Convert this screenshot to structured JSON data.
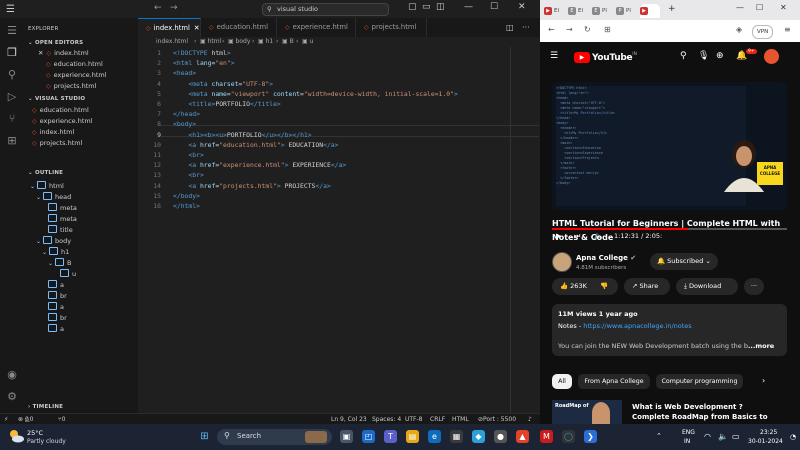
{
  "vscode": {
    "search": "visual studio",
    "explorer_title": "EXPLORER",
    "open_editors_title": "OPEN EDITORS",
    "open_editors": [
      "index.html",
      "education.html",
      "experience.html",
      "projects.html"
    ],
    "folder_title": "VISUAL STUDIO",
    "folder_files": [
      "education.html",
      "experience.html",
      "index.html",
      "projects.html"
    ],
    "outline_title": "OUTLINE",
    "outline": [
      "html",
      "head",
      "meta",
      "meta",
      "title",
      "body",
      "h1",
      "B",
      "u",
      "a",
      "br",
      "a",
      "br",
      "a"
    ],
    "timeline_title": "TIMELINE",
    "tabs": [
      "index.html",
      "education.html",
      "experience.html",
      "projects.html"
    ],
    "breadcrumb": [
      "index.html",
      "html",
      "body",
      "h1",
      "B",
      "u"
    ],
    "status": {
      "errors": "0",
      "warnings": "0",
      "ports": "0",
      "position": "Ln 9, Col 23",
      "spaces": "Spaces: 4",
      "encoding": "UTF-8",
      "eol": "CRLF",
      "language": "HTML",
      "port": "Port : 5500"
    },
    "code_lines": [
      "<!DOCTYPE html>",
      "<html lang=\"en\">",
      "<head>",
      "    <meta charset=\"UTF-8\">",
      "    <meta name=\"viewport\" content=\"width=device-width, initial-scale=1.0\">",
      "    <title>PORTFOLIO</title>",
      "</head>",
      "<body>",
      "    <h1><b><u>PORTFOLIO</u></b></h1>",
      "    <a href=\"education.html\"> EDUCATION</a>",
      "    <br>",
      "    <a href=\"experience.html\"> EXPERIENCE</a>",
      "    <br>",
      "    <a href=\"projects.html\"> PROJECTS</a>",
      "</body>",
      "</html>"
    ]
  },
  "browser": {
    "tab_labels": [
      "El",
      "El",
      "Pl",
      "Pl"
    ],
    "vpn": "VPN",
    "yt_brand": "YouTube",
    "yt_region": "IN",
    "notif_count": "9+",
    "time": "1:12:31 / 2:05:",
    "title_lines": [
      "HTML Tutorial for Beginners | Complete HTML with",
      "Notes & Code"
    ],
    "channel": "Apna College",
    "subs": "4.81M subscribers",
    "subscribed": "Subscribed",
    "likes": "263K",
    "share": "Share",
    "download": "Download",
    "more": "···",
    "views": "11M views  1 year ago",
    "notes_label": "Notes - ",
    "notes_link": "https://www.apnacollege.in/notes",
    "desc_text": "You can join the  NEW Web Development batch using the b",
    "desc_more": "...more",
    "chips": [
      "All",
      "From Apna College",
      "Computer programming"
    ],
    "rec_title": [
      "What is Web Development ?",
      "Complete RoadMap from Basics to"
    ],
    "rec_thumb": "RoadMap of",
    "thumb_badge": "APNA COLLEGE",
    "progress": 0.58
  },
  "taskbar": {
    "temp": "25°C",
    "weather": "Partly cloudy",
    "search": "Search",
    "lang": "ENG",
    "region": "IN",
    "time": "23:25",
    "date": "30-01-2024"
  }
}
